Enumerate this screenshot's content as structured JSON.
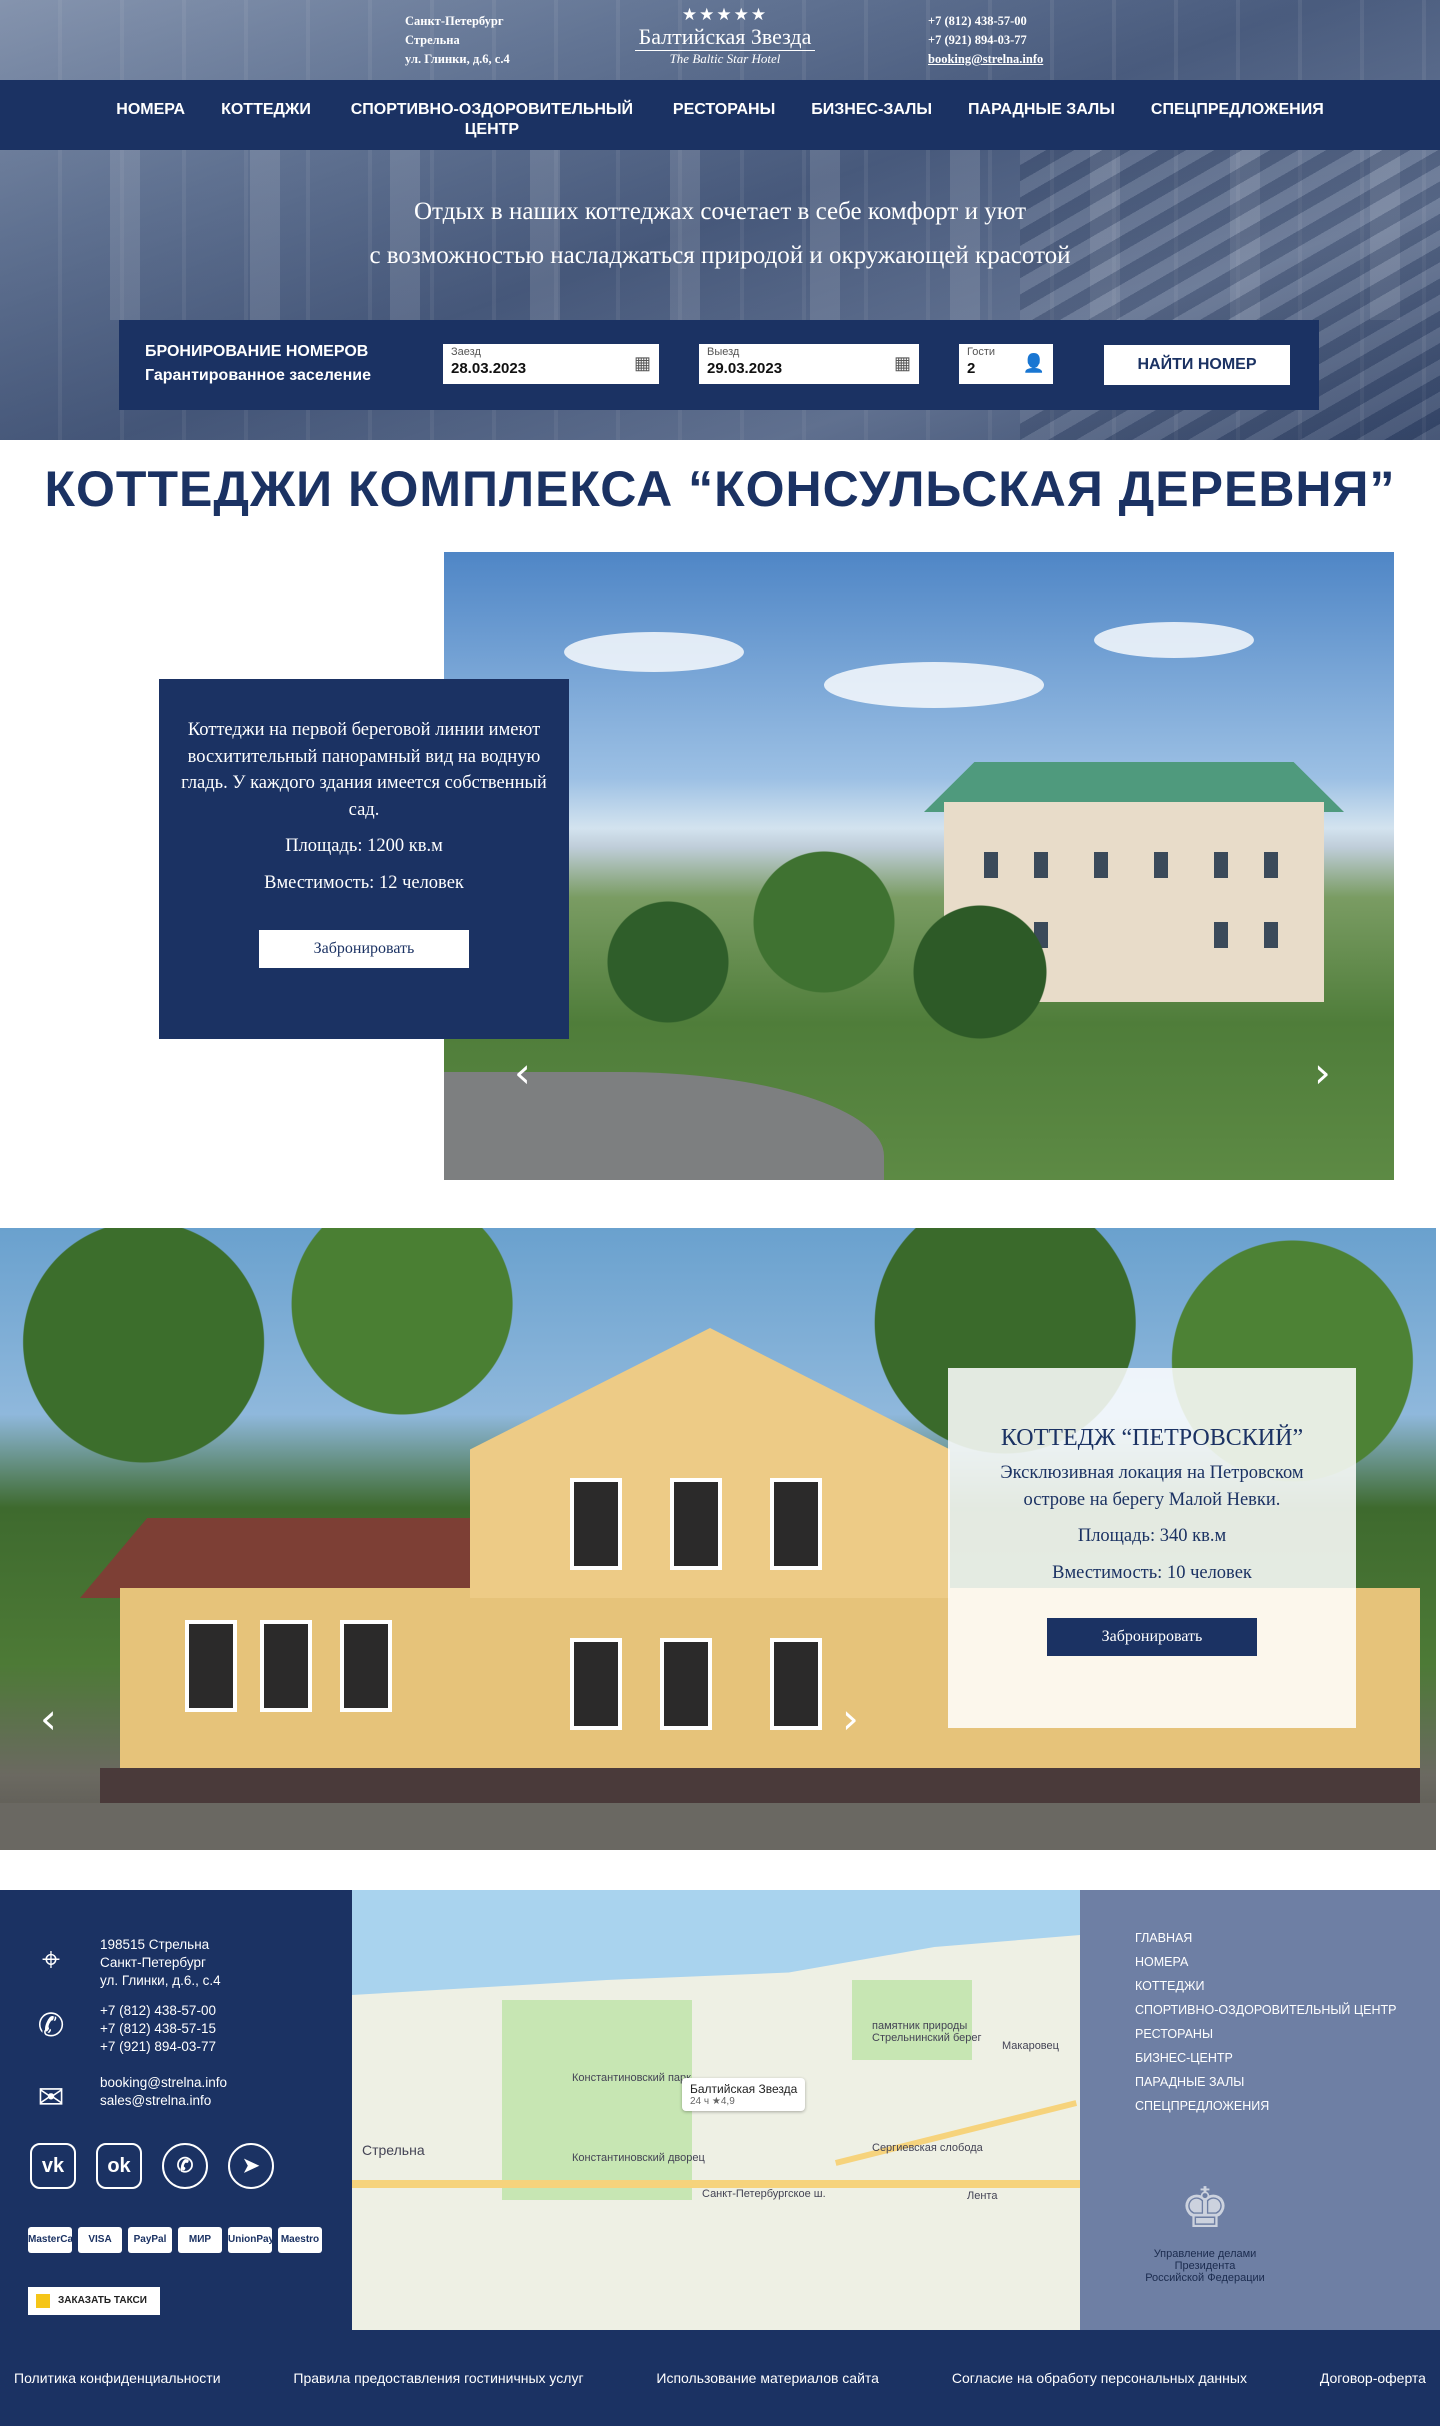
{
  "header": {
    "address": [
      "Санкт-Петербург",
      "Стрельна",
      "ул. Глинки, д.6, с.4"
    ],
    "phones": [
      "+7 (812) 438-57-00",
      "+7 (921) 894-03-77"
    ],
    "email": "booking@strelna.info",
    "logo_name": "Балтийская Звезда",
    "logo_sub": "The Baltic Star Hotel"
  },
  "nav": [
    "НОМЕРА",
    "КОТТЕДЖИ",
    "СПОРТИВНО-ОЗДОРОВИТЕЛЬНЫЙ ЦЕНТР",
    "РЕСТОРАНЫ",
    "БИЗНЕС-ЗАЛЫ",
    "ПАРАДНЫЕ ЗАЛЫ",
    "СПЕЦПРЕДЛОЖЕНИЯ"
  ],
  "hero": {
    "line1": "Отдых в наших коттеджах сочетает в себе комфорт и уют",
    "line2": "с возможностью насладжаться природой и окружающей красотой"
  },
  "booking": {
    "title": "БРОНИРОВАНИЕ НОМЕРОВ",
    "subtitle": "Гарантированное заселение",
    "checkin_label": "Заезд",
    "checkin_value": "28.03.2023",
    "checkout_label": "Выезд",
    "checkout_value": "29.03.2023",
    "guests_label": "Гости",
    "guests_value": "2",
    "button": "НАЙТИ НОМЕР"
  },
  "section_title": "КОТТЕДЖИ КОМПЛЕКСА “КОНСУЛЬСКАЯ ДЕРЕВНЯ”",
  "slide1": {
    "text": "Коттеджи на первой береговой линии имеют восхитительный панорамный вид на водную гладь. У каждого здания имеется собственный сад.",
    "area": "Площадь: 1200 кв.м",
    "capacity": "Вместимость: 12 человек",
    "button": "Забронировать"
  },
  "slide2": {
    "title": "КОТТЕДЖ “ПЕТРОВСКИЙ”",
    "text": "Эксклюзивная локация на Петровском острове на берегу Малой Невки.",
    "area": "Площадь: 340 кв.м",
    "capacity": "Вместимость: 10 человек",
    "button": "Забронировать"
  },
  "footer": {
    "address": [
      "198515 Стрельна",
      "Санкт-Петербург",
      "ул. Глинки, д.6., с.4"
    ],
    "phones": [
      "+7 (812) 438-57-00",
      "+7 (812) 438-57-15",
      "+7 (921) 894-03-77"
    ],
    "emails": [
      "booking@strelna.info",
      "sales@strelna.info"
    ],
    "payments": [
      "MasterCard",
      "VISA",
      "PayPal",
      "МИР",
      "UnionPay",
      "Maestro"
    ],
    "taxi": "ЗАКАЗАТЬ ТАКСИ",
    "menu": [
      "ГЛАВНАЯ",
      "НОМЕРА",
      "КОТТЕДЖИ",
      "СПОРТИВНО-ОЗДОРОВИТЕЛЬНЫЙ ЦЕНТР",
      "РЕСТОРАНЫ",
      "БИЗНЕС-ЦЕНТР",
      "ПАРАДНЫЕ ЗАЛЫ",
      "СПЕЦПРЕДЛОЖЕНИЯ"
    ],
    "emblem": [
      "Управление делами",
      "Президента",
      "Российской Федерации"
    ],
    "map": {
      "pin_name": "Балтийская Звезда",
      "pin_rating": "24 ч ★4,9",
      "labels": [
        "Константиновский парк",
        "Константиновский дворец",
        "Стрельна",
        "памятник природы Стрельнинский берег",
        "Санкт-Петербургское ш.",
        "Сергиевская слобода",
        "Лента",
        "Макаровец"
      ]
    }
  },
  "bottom_links": [
    "Политика конфиденциальности",
    "Правила предоставления гостиничных услуг",
    "Использование материалов сайта",
    "Согласие на обработу персональных данных",
    "Договор-оферта"
  ]
}
